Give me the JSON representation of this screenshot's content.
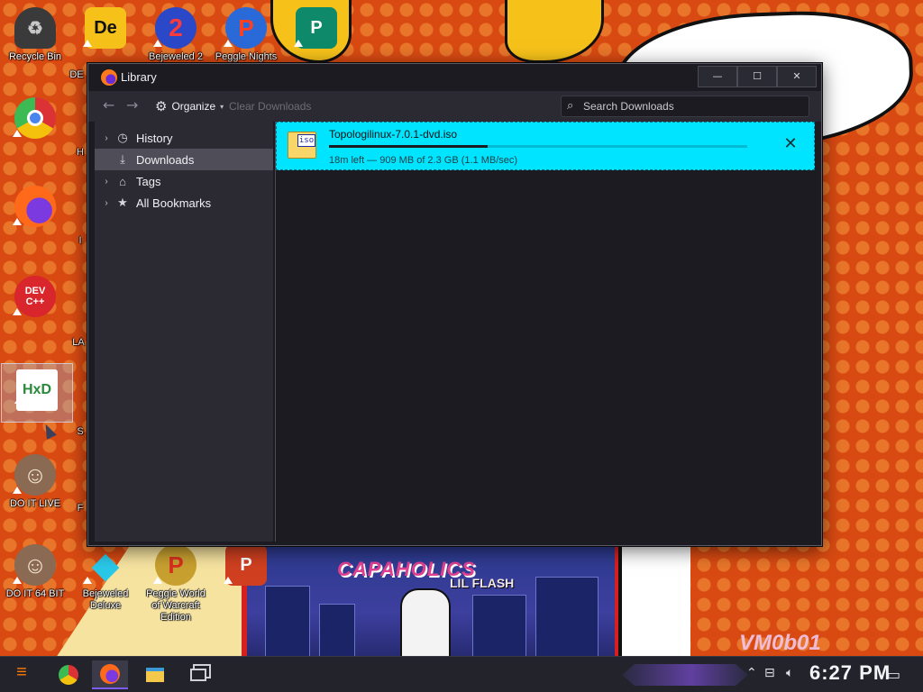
{
  "desktop": {
    "icons": [
      {
        "label": "Recycle Bin",
        "glyph": "♻"
      },
      {
        "label": "",
        "glyph": "De"
      },
      {
        "label": "Bejeweled 2",
        "glyph": "2"
      },
      {
        "label": "Peggle Nights",
        "glyph": "P"
      },
      {
        "label": "",
        "glyph": "P"
      },
      {
        "label": "",
        "glyph": "●"
      },
      {
        "label": "",
        "glyph": "●"
      },
      {
        "label": "",
        "glyph": "DEV\nC++"
      },
      {
        "label": "",
        "glyph": "HxD"
      },
      {
        "label": "DO IT LIVE",
        "glyph": "☺"
      },
      {
        "label": "DO IT 64 BIT",
        "glyph": "☺"
      },
      {
        "label": "Bejeweled Deluxe",
        "glyph": "◆"
      },
      {
        "label": "Peggle World of Warcraft Edition",
        "glyph": "P"
      },
      {
        "label": "",
        "glyph": "P"
      }
    ],
    "partial_labels": [
      "DE",
      "H",
      "I",
      "LA",
      "S",
      "F"
    ],
    "wallpaper": {
      "speech_bubble": [
        "",
        ""
      ],
      "album_title": "CAPAHOLICS",
      "album_subtitle": "LIL FLASH",
      "watermark": "VM0b01"
    }
  },
  "window": {
    "title": "Library",
    "controls": {
      "minimize": "—",
      "maximize": "☐",
      "close": "✕"
    },
    "toolbar": {
      "back": "←",
      "forward": "→",
      "organize": "Organize",
      "clear_downloads": "Clear Downloads",
      "search_placeholder": "Search Downloads"
    },
    "sidebar": {
      "items": [
        {
          "label": "History",
          "icon": "clock-icon"
        },
        {
          "label": "Downloads",
          "icon": "download-icon"
        },
        {
          "label": "Tags",
          "icon": "tag-icon"
        },
        {
          "label": "All Bookmarks",
          "icon": "star-icon"
        }
      ]
    },
    "downloads": [
      {
        "icon_text": "iso",
        "filename": "Topologilinux-7.0.1-dvd.iso",
        "status": "18m left — 909 MB of 2.3 GB (1.1 MB/sec)",
        "progress": 0.38
      }
    ]
  },
  "taskbar": {
    "clock": "6:27 PM",
    "start_glyph": "≡"
  },
  "colors": {
    "accent_highlight": "#00e4ff",
    "window_bg": "#1c1b22",
    "toolbar_bg": "#2b2a33"
  }
}
